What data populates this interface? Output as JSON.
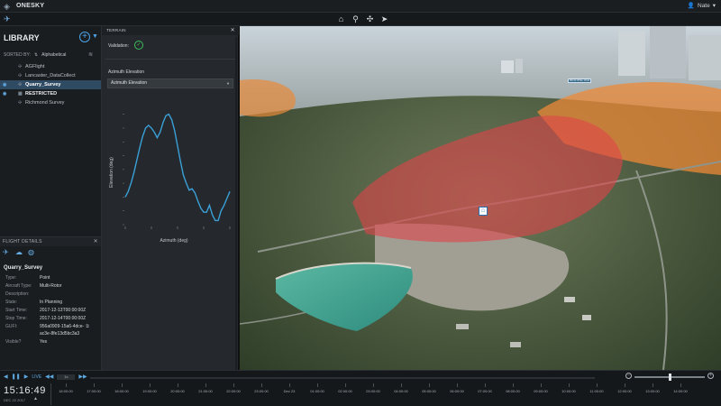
{
  "app": {
    "title": "ONESKY",
    "user": "Nate"
  },
  "library": {
    "title": "LIBRARY",
    "sort_label": "SORTED BY:",
    "sort_value": "Alphabetical",
    "items": [
      {
        "label": "AGFlight"
      },
      {
        "label": "Lancaster_DataCollect"
      },
      {
        "label": "Quarry_Survey"
      },
      {
        "label": "RESTRICTED"
      },
      {
        "label": "Richmond Survey"
      }
    ]
  },
  "details": {
    "header": "FLIGHT DETAILS",
    "name": "Quarry_Survey",
    "fields": [
      {
        "k": "Type:",
        "v": "Point"
      },
      {
        "k": "Aircraft Type:",
        "v": "Multi-Rotor"
      },
      {
        "k": "Description:",
        "v": ""
      },
      {
        "k": "State:",
        "v": "In Planning"
      },
      {
        "k": "Start Time:",
        "v": "2017-12-13T00:00:00Z"
      },
      {
        "k": "Stop Time:",
        "v": "2017-12-14T00:00:00Z"
      },
      {
        "k": "GUFI:",
        "v": "956a0909-15a6-4dce-"
      },
      {
        "k": "",
        "v": "ac3e-8fe13d5bc3a3"
      },
      {
        "k": "Visible?",
        "v": "Yes"
      }
    ]
  },
  "terrain": {
    "header": "TERRAIN",
    "validation_label": "Validation:",
    "azel_label": "Azimuth Elevation",
    "azel_select": "Azimuth Elevation"
  },
  "chart_data": {
    "type": "line",
    "xlabel": "Azimuth (deg)",
    "ylabel": "Elevation (deg)",
    "color": "#3aa0d8",
    "x": [
      0,
      5,
      10,
      15,
      20,
      25,
      30,
      35,
      40,
      45,
      50,
      55,
      60,
      65,
      70,
      75,
      80,
      85,
      90,
      95,
      100,
      105,
      110,
      115,
      120,
      125,
      130,
      135,
      140,
      145,
      150,
      155,
      160,
      165,
      170,
      175,
      180
    ],
    "y": [
      2.0,
      2.4,
      3.0,
      3.8,
      4.7,
      5.6,
      6.4,
      7.0,
      7.2,
      7.0,
      6.7,
      6.3,
      6.7,
      7.4,
      7.9,
      8.0,
      7.6,
      6.8,
      5.7,
      4.6,
      3.6,
      3.0,
      2.5,
      2.6,
      2.3,
      1.7,
      1.2,
      0.9,
      0.9,
      1.4,
      0.7,
      0.3,
      0.3,
      1.0,
      1.4,
      1.9,
      2.4
    ],
    "xlim": [
      0,
      180
    ],
    "ylim": [
      0,
      8.5
    ]
  },
  "timeline": {
    "live": "LIVE",
    "speed": "1x",
    "clock": "15:16:49",
    "date": "DEC 22 2017",
    "ticks": [
      "18:00:00",
      "17:00:00",
      "18:00:00",
      "19:00:00",
      "20:00:00",
      "21:00:00",
      "22:00:00",
      "23:00:00",
      "Dec 23",
      "01:00:00",
      "02:00:00",
      "03:00:00",
      "04:00:00",
      "05:00:00",
      "06:00:00",
      "07:00:00",
      "08:00:00",
      "09:00:00",
      "10:00:00",
      "11:00:00",
      "12:00:00",
      "13:00:00",
      "14:00:00"
    ]
  },
  "map": {
    "tag": "RESTRICTED"
  }
}
